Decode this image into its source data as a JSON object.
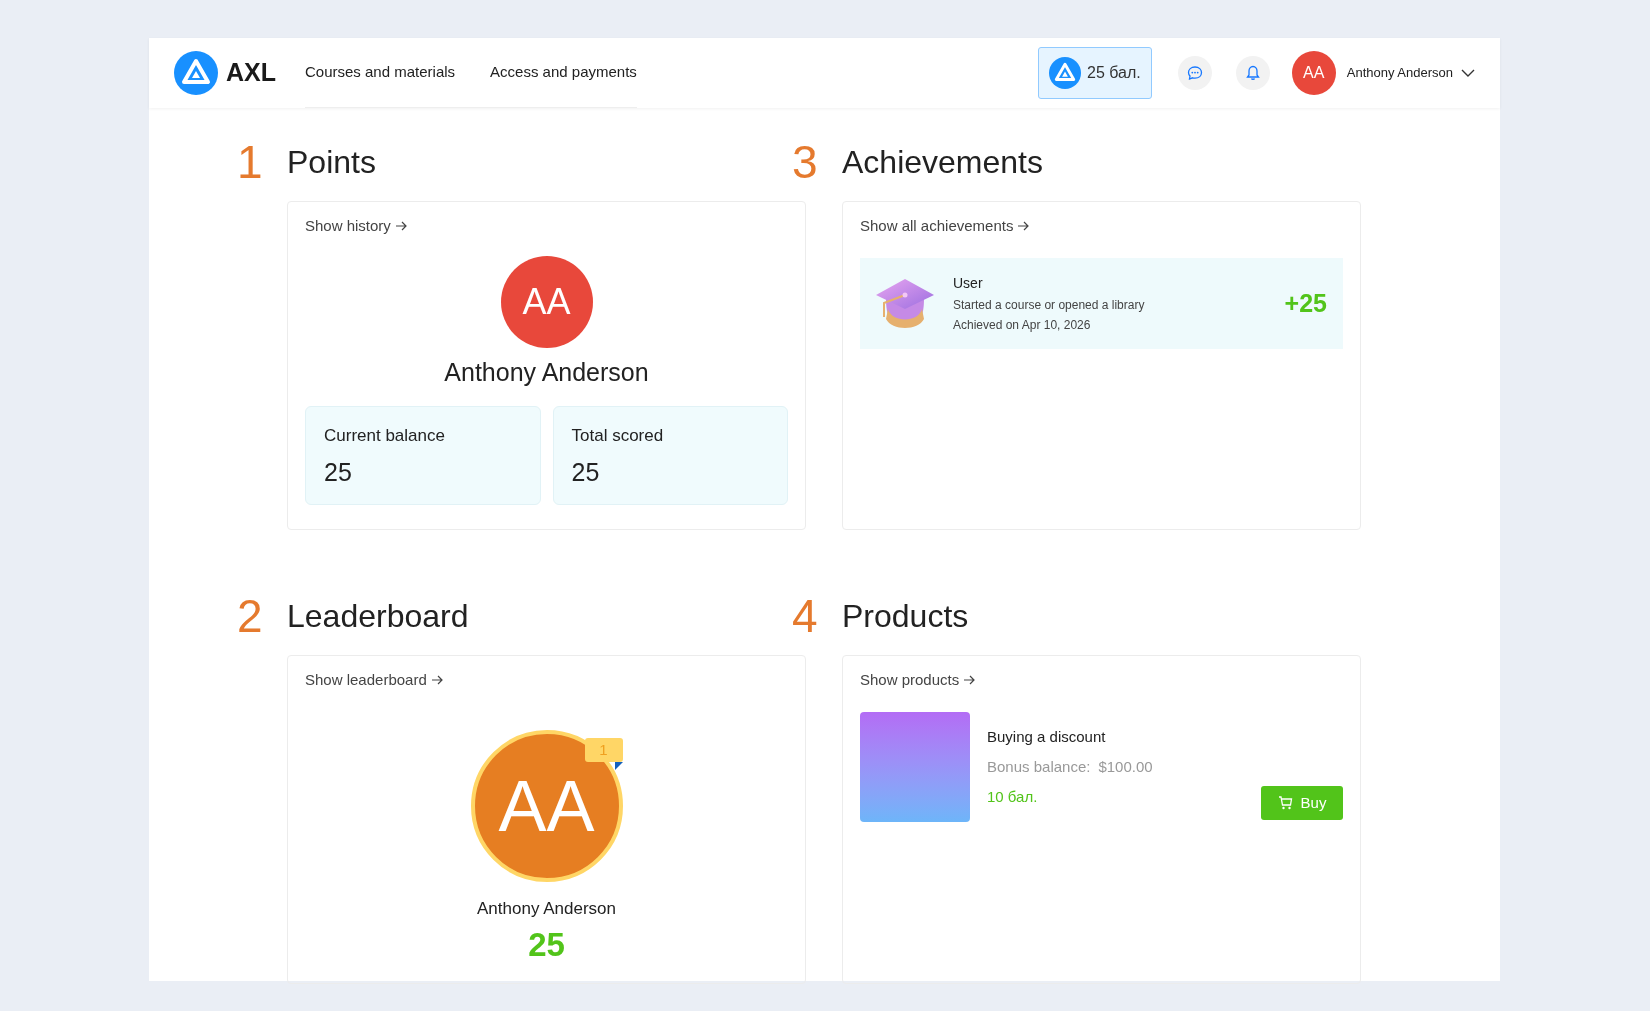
{
  "header": {
    "logo_text": "AXL",
    "nav": [
      {
        "label": "Courses and materials"
      },
      {
        "label": "Access and payments"
      }
    ],
    "points_badge": "25 бал.",
    "user": {
      "initials": "AA",
      "name": "Anthony Anderson"
    }
  },
  "points": {
    "number": "1",
    "title": "Points",
    "link": "Show history",
    "initials": "AA",
    "name": "Anthony Anderson",
    "stats": [
      {
        "label": "Current balance",
        "value": "25"
      },
      {
        "label": "Total scored",
        "value": "25"
      }
    ]
  },
  "achievements": {
    "number": "3",
    "title": "Achievements",
    "link": "Show all achievements",
    "items": [
      {
        "title": "User",
        "description": "Started a course or opened a library",
        "date": "Achieved on Apr 10, 2026",
        "points": "+25"
      }
    ]
  },
  "leaderboard": {
    "number": "2",
    "title": "Leaderboard",
    "link": "Show leaderboard",
    "entries": [
      {
        "initials": "AA",
        "name": "Anthony Anderson",
        "score": "25",
        "rank": "1"
      }
    ]
  },
  "products": {
    "number": "4",
    "title": "Products",
    "link": "Show products",
    "items": [
      {
        "title": "Buying a discount",
        "bonus_label": "Bonus balance:",
        "bonus_value": "$100.00",
        "price": "10 бал.",
        "button": "Buy"
      }
    ]
  }
}
